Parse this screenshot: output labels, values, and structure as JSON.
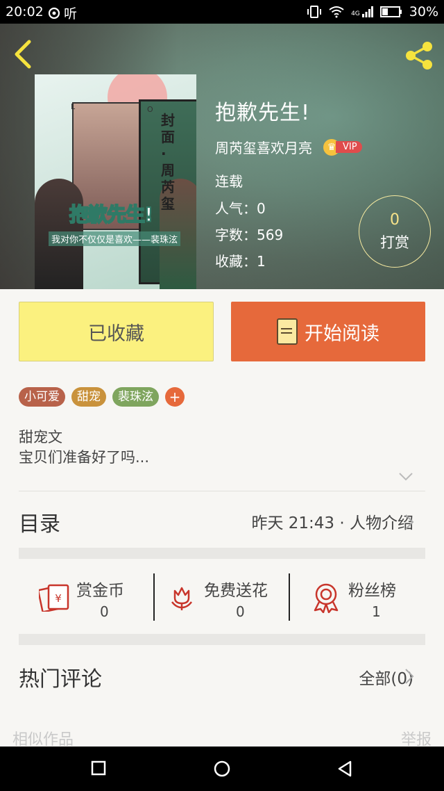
{
  "status_bar": {
    "time": "20:02",
    "listen": "听",
    "network": "4G",
    "battery": "30%"
  },
  "book": {
    "title": "抱歉先生!",
    "author": "周芮玺喜欢月亮",
    "vip_badge": "VIP",
    "status": "连载",
    "popularity": "人气：0",
    "word_count": "字数：569",
    "favorites": "收藏：1",
    "cover": {
      "title": "抱歉先生!",
      "subtitle": "我对你不仅仅是喜欢——裴珠泫",
      "vertical_text": "封面·周芮玺",
      "corner_left": "L",
      "corner_right": "O"
    }
  },
  "reward": {
    "count": "0",
    "label": "打赏"
  },
  "actions": {
    "collected_label": "已收藏",
    "read_label": "开始阅读"
  },
  "tags": [
    {
      "label": "小可爱",
      "color": "#b8624a"
    },
    {
      "label": "甜宠",
      "color": "#c9923c"
    },
    {
      "label": "裴珠泫",
      "color": "#7fa55e"
    }
  ],
  "tag_add": "+",
  "description": {
    "line1": "甜宠文",
    "line2": "宝贝们准备好了吗..."
  },
  "toc": {
    "label": "目录",
    "latest": "昨天 21:43 · 人物介绍"
  },
  "stats": [
    {
      "label": "赏金币",
      "value": "0"
    },
    {
      "label": "免费送花",
      "value": "0"
    },
    {
      "label": "粉丝榜",
      "value": "1"
    }
  ],
  "comments": {
    "label": "热门评论",
    "all": "全部(0)"
  },
  "footer": {
    "similar": "相似作品",
    "report": "举报"
  },
  "colors": {
    "accent": "#e6693b",
    "collected": "#fbf17f",
    "icon_red": "#c8352b"
  }
}
